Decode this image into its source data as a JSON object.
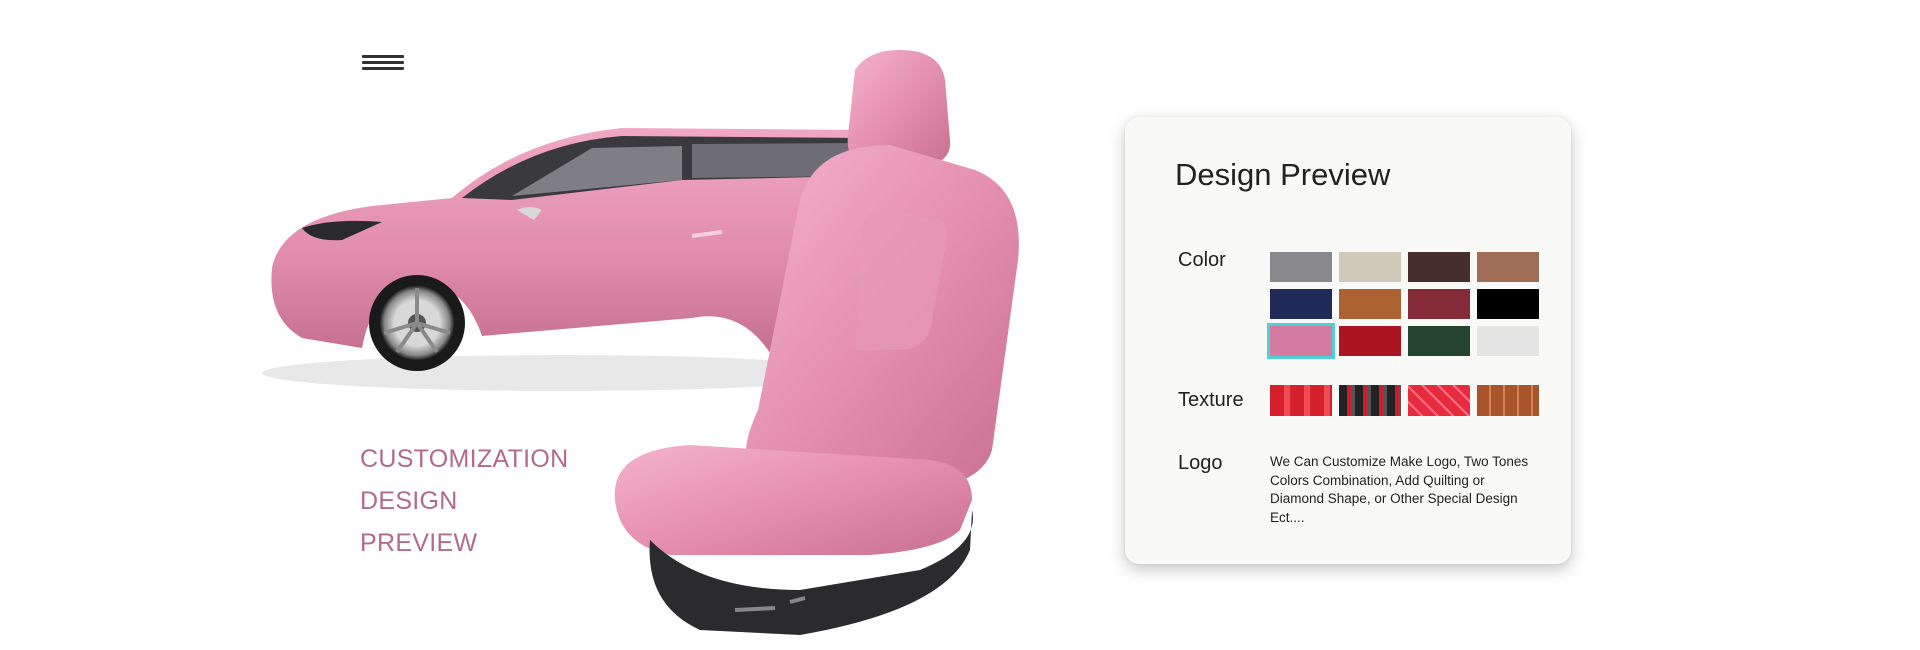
{
  "menu": {
    "icon": "hamburger-menu-icon"
  },
  "headline": {
    "line1": "CUSTOMIZATION",
    "line2": "DESIGN",
    "line3": "PREVIEW"
  },
  "panel": {
    "title": "Design Preview",
    "color_label": "Color",
    "texture_label": "Texture",
    "logo_label": "Logo",
    "logo_text": "We Can Customize Make Logo, Two Tones Colors Combination, Add Quilting or Diamond Shape, or Other Special Design Ect....",
    "selected_color_index": 8,
    "colors": [
      "#89888d",
      "#d0c8b8",
      "#47302b",
      "#a06e56",
      "#1f2a56",
      "#ad6234",
      "#842a39",
      "#000000",
      "#d47b9f",
      "#ac1422",
      "#25452f",
      "#e5e5e5"
    ],
    "textures": [
      "red-perforated-texture",
      "black-red-stripe-texture",
      "red-diamond-quilt-texture",
      "brown-stitched-texture"
    ]
  },
  "theme": {
    "accent": "#b46a8c",
    "selection": "#4fd0d8",
    "car_color": "#e28fb0"
  }
}
